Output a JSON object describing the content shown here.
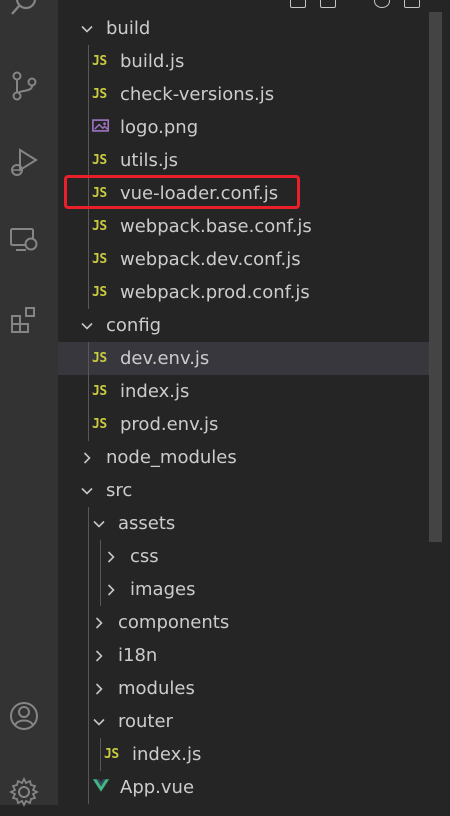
{
  "explorer": {
    "tree": [
      {
        "label": "build",
        "type": "folder",
        "expanded": true,
        "depth": 0
      },
      {
        "label": "build.js",
        "type": "js",
        "depth": 1
      },
      {
        "label": "check-versions.js",
        "type": "js",
        "depth": 1
      },
      {
        "label": "logo.png",
        "type": "png",
        "depth": 1
      },
      {
        "label": "utils.js",
        "type": "js",
        "depth": 1
      },
      {
        "label": "vue-loader.conf.js",
        "type": "js",
        "depth": 1,
        "outlined": true
      },
      {
        "label": "webpack.base.conf.js",
        "type": "js",
        "depth": 1
      },
      {
        "label": "webpack.dev.conf.js",
        "type": "js",
        "depth": 1
      },
      {
        "label": "webpack.prod.conf.js",
        "type": "js",
        "depth": 1
      },
      {
        "label": "config",
        "type": "folder",
        "expanded": true,
        "depth": 0
      },
      {
        "label": "dev.env.js",
        "type": "js",
        "depth": 1,
        "highlighted": true
      },
      {
        "label": "index.js",
        "type": "js",
        "depth": 1
      },
      {
        "label": "prod.env.js",
        "type": "js",
        "depth": 1
      },
      {
        "label": "node_modules",
        "type": "folder",
        "expanded": false,
        "depth": 0
      },
      {
        "label": "src",
        "type": "folder",
        "expanded": true,
        "depth": 0
      },
      {
        "label": "assets",
        "type": "folder",
        "expanded": true,
        "depth": 1
      },
      {
        "label": "css",
        "type": "folder",
        "expanded": false,
        "depth": 2
      },
      {
        "label": "images",
        "type": "folder",
        "expanded": false,
        "depth": 2
      },
      {
        "label": "components",
        "type": "folder",
        "expanded": false,
        "depth": 1
      },
      {
        "label": "i18n",
        "type": "folder",
        "expanded": false,
        "depth": 1
      },
      {
        "label": "modules",
        "type": "folder",
        "expanded": false,
        "depth": 1
      },
      {
        "label": "router",
        "type": "folder",
        "expanded": true,
        "depth": 1
      },
      {
        "label": "index.js",
        "type": "js",
        "depth": 2
      },
      {
        "label": "App.vue",
        "type": "vue",
        "depth": 1
      }
    ]
  },
  "icons": {
    "js": "JS",
    "activity": [
      "search-icon",
      "source-control-icon",
      "run-debug-icon",
      "remote-explorer-icon",
      "extensions-icon",
      "account-icon",
      "settings-gear-icon"
    ]
  },
  "colors": {
    "activity_bar": "#333333",
    "sidebar": "#252526",
    "js_icon": "#cbcb41",
    "vue_icon": "#41b883",
    "png_icon": "#a074c4",
    "outline": "#e8202a"
  }
}
